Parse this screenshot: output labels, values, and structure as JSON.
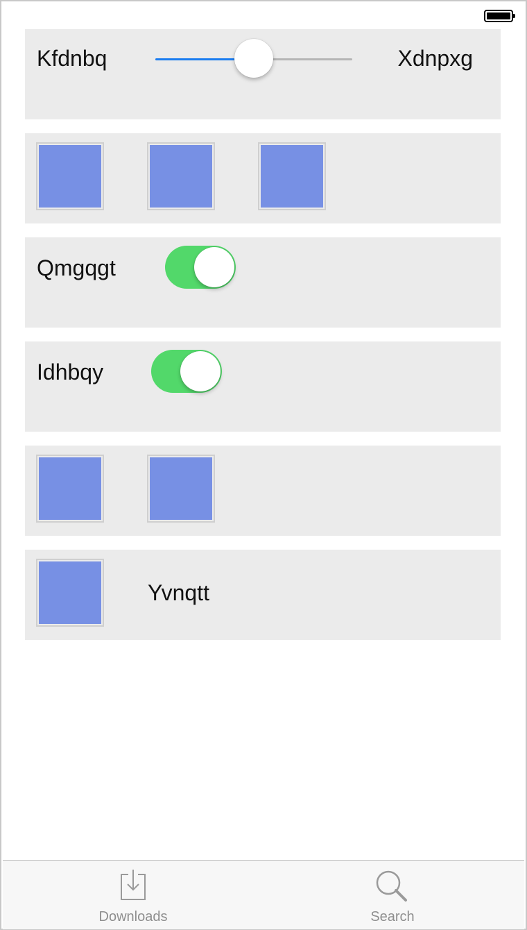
{
  "slider_row": {
    "left_label": "Kfdnbq",
    "right_label": "Xdnpxg",
    "value_fraction": 0.5
  },
  "toggle_rows": [
    {
      "label": "Qmgqgt",
      "on": true
    },
    {
      "label": "Idhbqy",
      "on": true
    }
  ],
  "tile_rows": [
    {
      "tile_count": 3
    },
    {
      "tile_count": 2
    }
  ],
  "image_label_row": {
    "label": "Yvnqtt"
  },
  "tabbar": {
    "downloads_label": "Downloads",
    "search_label": "Search"
  },
  "colors": {
    "accent_blue": "#1a7cf0",
    "toggle_on_green": "#52d86a",
    "tile_blue": "#7790e4",
    "row_background": "#ebebeb"
  },
  "icons": {
    "battery": "battery-icon",
    "downloads": "download-tray-icon",
    "search": "magnifying-glass-icon"
  }
}
